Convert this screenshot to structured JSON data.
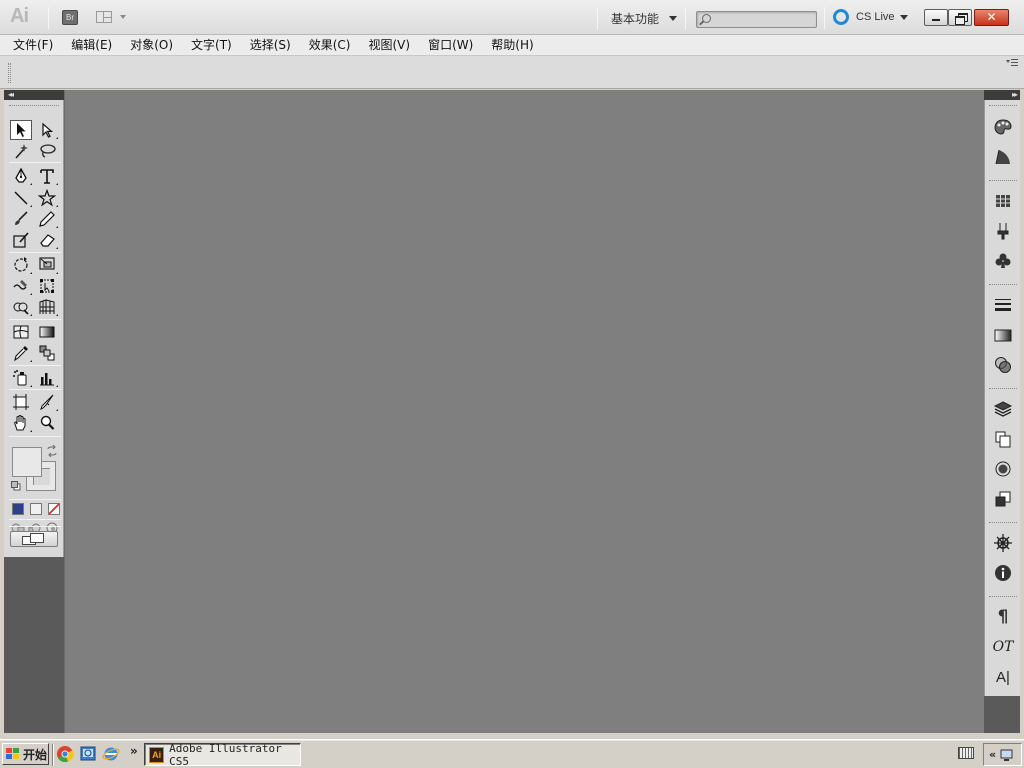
{
  "app": {
    "logo": "Ai",
    "bridge_label": "Br",
    "workspace_label": "基本功能",
    "search": {
      "value": "",
      "placeholder": ""
    },
    "cs_live_label": "CS Live",
    "close_glyph": "✕"
  },
  "menu": {
    "items": [
      {
        "label": "文件(F)"
      },
      {
        "label": "编辑(E)"
      },
      {
        "label": "对象(O)"
      },
      {
        "label": "文字(T)"
      },
      {
        "label": "选择(S)"
      },
      {
        "label": "效果(C)"
      },
      {
        "label": "视图(V)"
      },
      {
        "label": "窗口(W)"
      },
      {
        "label": "帮助(H)"
      }
    ]
  },
  "tools": {
    "collapse_glyph": "◂◂",
    "icons": [
      "selection-icon",
      "direct-selection-icon",
      "magic-wand-icon",
      "lasso-icon",
      "pen-icon",
      "type-icon",
      "line-segment-icon",
      "star-icon",
      "paintbrush-icon",
      "pencil-icon",
      "blob-brush-icon",
      "eraser-icon",
      "rotate-icon",
      "scale-icon",
      "warp-icon",
      "free-transform-icon",
      "shape-builder-icon",
      "perspective-grid-icon",
      "mesh-icon",
      "gradient-icon",
      "eyedropper-icon",
      "blend-icon",
      "symbol-sprayer-icon",
      "column-graph-icon",
      "artboard-icon",
      "slice-icon",
      "hand-icon",
      "zoom-icon"
    ],
    "selected": "selection-icon",
    "fill_color": "#e8e8e8",
    "stroke_color": "#e8e8e8",
    "mode_colors": {
      "color": "#2f3f8f",
      "gradient": "#f0f0f0",
      "none": "#e0322a"
    }
  },
  "right_dock": {
    "collapse_glyph": "▸▸",
    "icons": [
      "color-icon",
      "color-guide-icon",
      "swatches-icon",
      "brushes-icon",
      "symbols-icon",
      "stroke-icon",
      "gradient-panel-icon",
      "transparency-icon",
      "appearance-icon",
      "graphic-styles-icon",
      "layers-icon",
      "artboards-icon",
      "navigator-icon",
      "info-icon",
      "paragraph-icon",
      "opentype-icon",
      "character-icon"
    ],
    "paragraph_glyph": "¶",
    "opentype_glyph": "OT",
    "character_glyph": "A|"
  },
  "taskbar": {
    "start_label": "开始",
    "more_glyph": "»",
    "task_label": "Adobe Illustrator CS5",
    "task_icon_label": "Ai",
    "tray_glyph": "«"
  }
}
